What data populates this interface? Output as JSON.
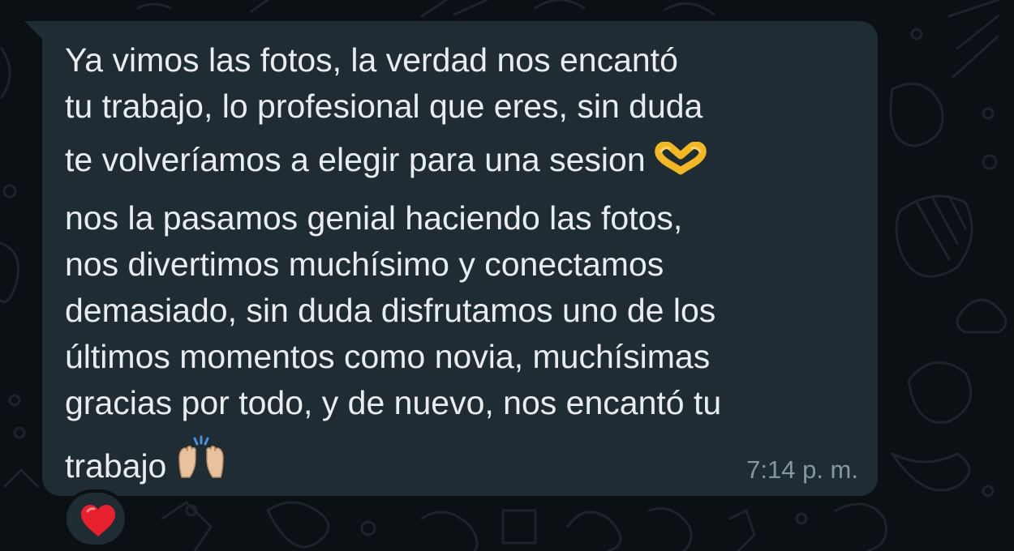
{
  "message": {
    "lines": [
      "Ya vimos las fotos, la verdad nos encantó",
      "tu trabajo, lo profesional que eres, sin duda",
      "te volveríamos a elegir para una sesion",
      "nos la pasamos genial haciendo las fotos,",
      "nos divertimos muchísimo y conectamos",
      "demasiado, sin duda disfrutamos uno de los",
      "últimos momentos como novia, muchísimas",
      "gracias por todo, y de nuevo, nos encantó tu",
      "trabajo"
    ],
    "emoji_line3": "heart-hands-icon",
    "emoji_line9": "raising-hands-icon",
    "timestamp": "7:14 p. m."
  },
  "reaction": {
    "icon": "red-heart-icon",
    "color": "#e8202e"
  },
  "colors": {
    "background": "#0b1014",
    "bubble": "#1f2c34",
    "text": "#e9edef",
    "timestamp": "#8696a0"
  }
}
